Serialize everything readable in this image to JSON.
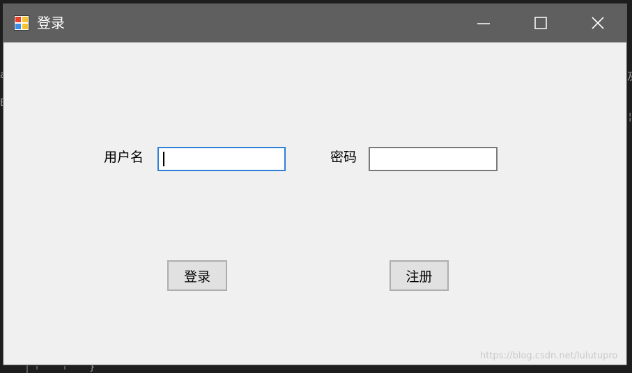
{
  "window": {
    "title": "登录",
    "icons": {
      "app": "app-window-icon",
      "minimize": "minimize-icon",
      "maximize": "maximize-icon",
      "close": "close-icon"
    }
  },
  "form": {
    "username_label": "用户名",
    "username_value": "",
    "password_label": "密码",
    "password_value": "",
    "login_button": "登录",
    "register_button": "注册"
  },
  "watermark": "https://blog.csdn.net/lulutupro",
  "background": {
    "left_glyph_1": "a",
    "left_glyph_2": "E",
    "right_glyph_1": "及",
    "right_glyph_2": "¦",
    "bottom_glyph": "}"
  },
  "colors": {
    "titlebar": "#5f5f5f",
    "window_bg": "#f0f0f0",
    "focus_border": "#2f7fd4",
    "button_bg": "#e1e1e1"
  }
}
